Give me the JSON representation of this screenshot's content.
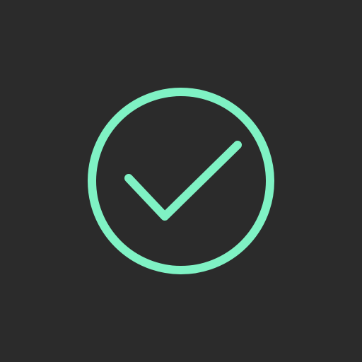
{
  "screen": {
    "background_color": "#2b2b2b"
  },
  "status_icon": {
    "name": "check-circle-icon",
    "state": "success",
    "color": "#7ff2c4"
  }
}
